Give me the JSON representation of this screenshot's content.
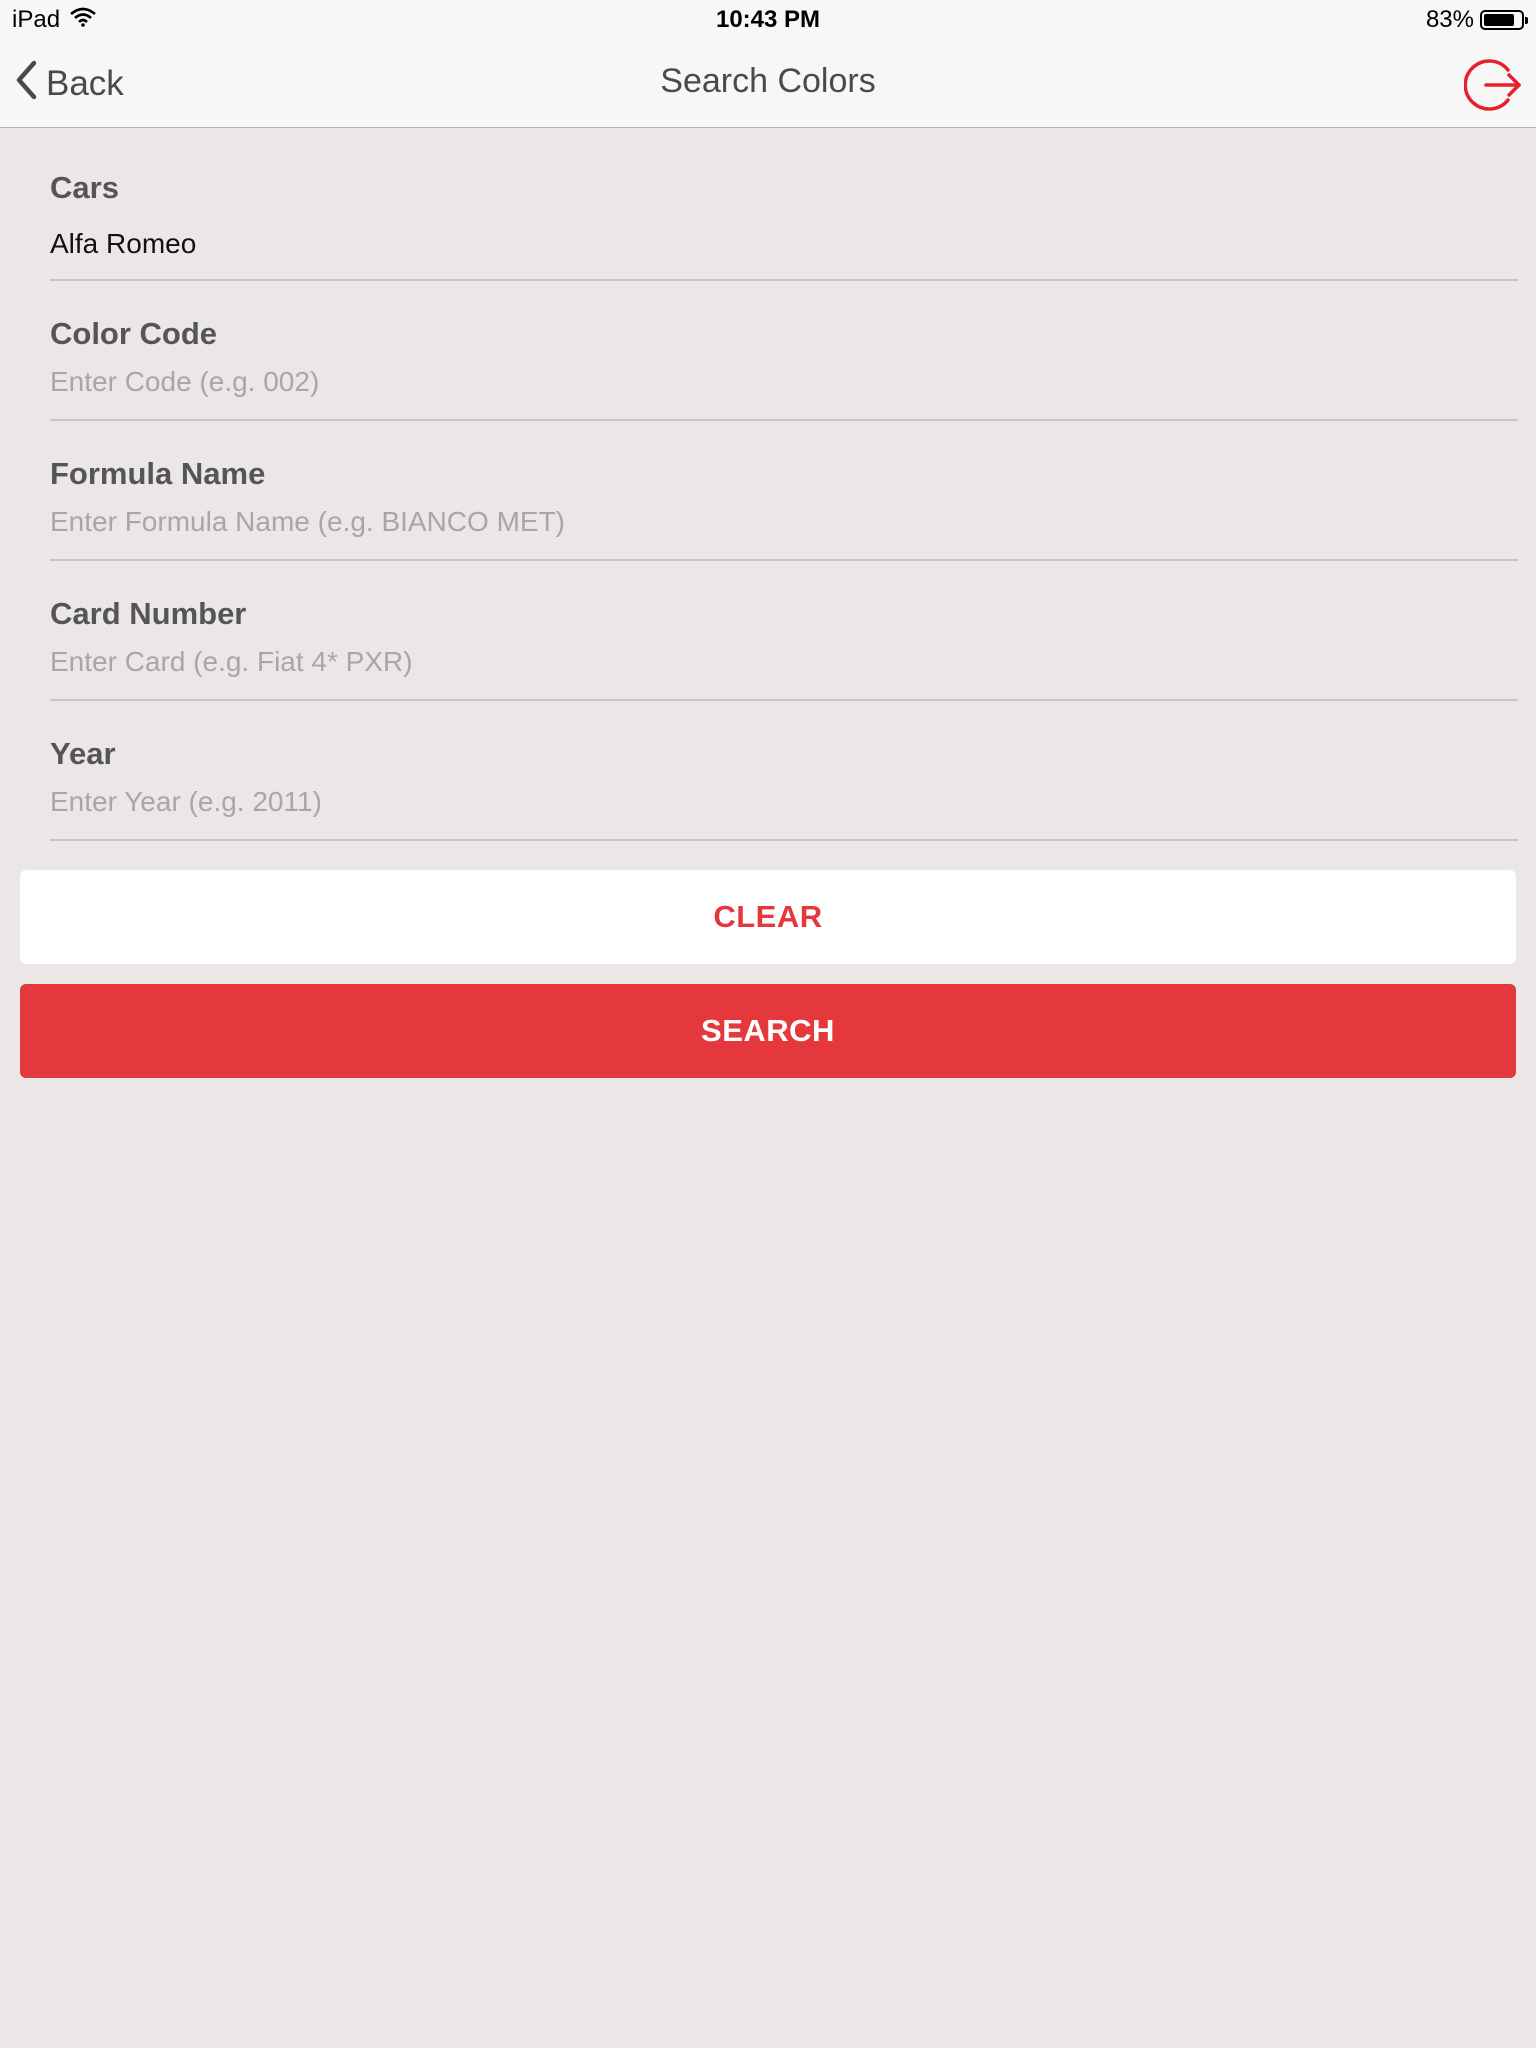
{
  "status_bar": {
    "device": "iPad",
    "time": "10:43 PM",
    "battery": "83%",
    "battery_level": 0.83
  },
  "nav": {
    "back_label": "Back",
    "title": "Search Colors",
    "logout_icon": "logout-icon",
    "accent_color": "#e5383d"
  },
  "form": {
    "fields": [
      {
        "label": "Cars",
        "value": "Alfa Romeo",
        "placeholder": ""
      },
      {
        "label": "Color Code",
        "value": "",
        "placeholder": "Enter Code (e.g. 002)"
      },
      {
        "label": "Formula Name",
        "value": "",
        "placeholder": "Enter Formula Name (e.g. BIANCO MET)"
      },
      {
        "label": "Card Number",
        "value": "",
        "placeholder": "Enter Card (e.g. Fiat 4* PXR)"
      },
      {
        "label": "Year",
        "value": "",
        "placeholder": "Enter Year (e.g. 2011)"
      }
    ]
  },
  "buttons": {
    "clear_label": "CLEAR",
    "search_label": "SEARCH"
  }
}
